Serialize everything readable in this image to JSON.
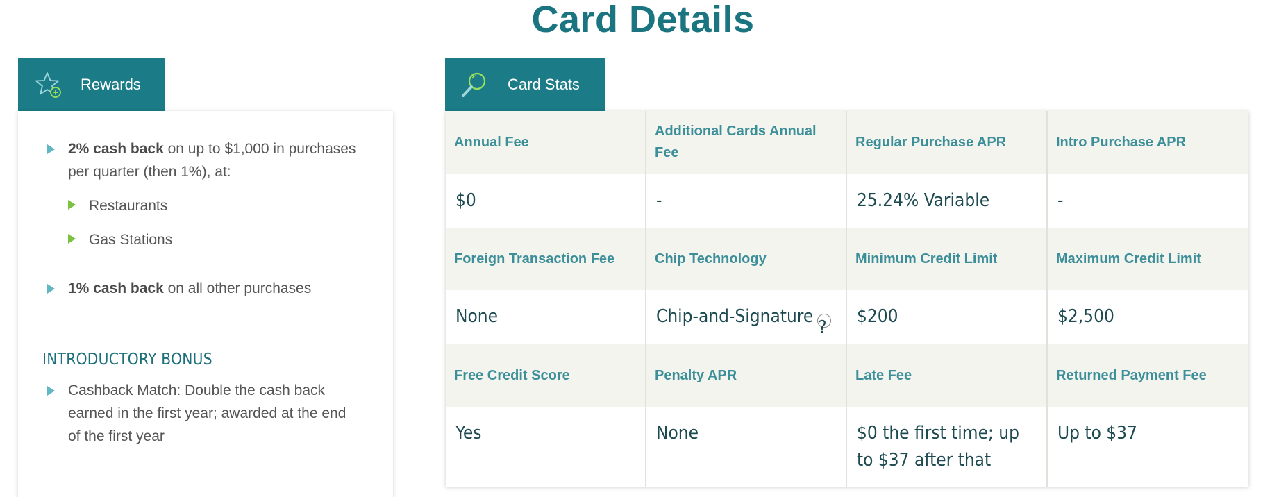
{
  "page": {
    "title": "Card Details"
  },
  "tabs": {
    "rewards": {
      "label": "Rewards",
      "icon": "star-plus-icon"
    },
    "stats": {
      "label": "Card Stats",
      "icon": "magnifier-icon"
    }
  },
  "rewards": {
    "items": [
      {
        "bold": "2% cash back",
        "text": " on up to $1,000 in purchases per quarter (then 1%), at:"
      },
      {
        "bold": "1% cash back",
        "text": " on all other purchases"
      }
    ],
    "sub_items": [
      "Restaurants",
      "Gas Stations"
    ],
    "intro_heading": "INTRODUCTORY BONUS",
    "intro_text": "Cashback Match: Double the cash back earned in the first year; awarded at the end of the first year"
  },
  "stats": {
    "rows": [
      {
        "labels": [
          "Annual Fee",
          "Additional Cards Annual Fee",
          "Regular Purchase APR",
          "Intro Purchase APR"
        ],
        "values": [
          "$0",
          "-",
          "25.24% Variable",
          "-"
        ]
      },
      {
        "labels": [
          "Foreign Transaction Fee",
          "Chip Technology",
          "Minimum Credit Limit",
          "Maximum Credit Limit"
        ],
        "values": [
          "None",
          "Chip-and-Signature",
          "$200",
          "$2,500"
        ]
      },
      {
        "labels": [
          "Free Credit Score",
          "Penalty APR",
          "Late Fee",
          "Returned Payment Fee"
        ],
        "values": [
          "Yes",
          "None",
          "$0 the first time; up to $37 after that",
          "Up to $37"
        ]
      }
    ],
    "help_glyph": "?"
  },
  "colors": {
    "accent": "#1b7c87",
    "title": "#1b7580",
    "label": "#3c8f99",
    "value": "#1d4a50",
    "header_bg": "#f4f4ef",
    "bullet_blue": "#5fb8c4",
    "bullet_green": "#7cc242"
  }
}
